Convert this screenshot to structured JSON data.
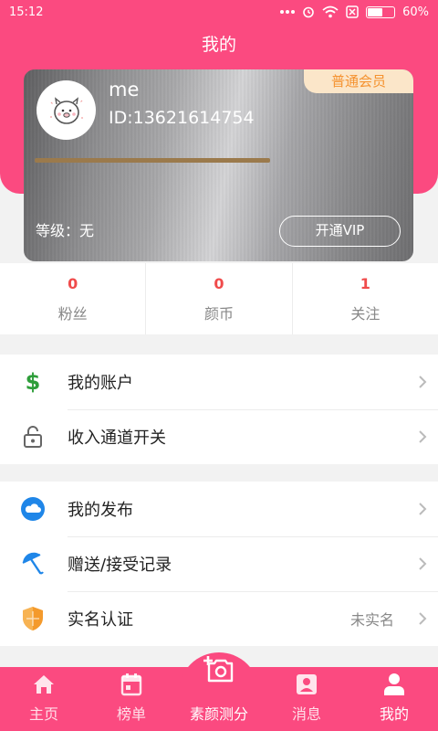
{
  "status_bar": {
    "time": "15:12",
    "battery": "60%",
    "battery_level": 0.6
  },
  "header": {
    "title": "我的"
  },
  "profile": {
    "username": "me",
    "id_text": "ID:13621614754",
    "member_badge": "普通会员",
    "level_text": "等级：无",
    "vip_button": "开通VIP",
    "progress": 1.0
  },
  "stats": [
    {
      "value": "0",
      "label": "粉丝"
    },
    {
      "value": "0",
      "label": "颜币"
    },
    {
      "value": "1",
      "label": "关注"
    }
  ],
  "menu_group1": [
    {
      "label": "我的账户",
      "icon": "dollar-icon"
    },
    {
      "label": "收入通道开关",
      "icon": "lock-icon"
    }
  ],
  "menu_group2": [
    {
      "label": "我的发布",
      "icon": "cloud-icon"
    },
    {
      "label": "赠送/接受记录",
      "icon": "umbrella-icon"
    },
    {
      "label": "实名认证",
      "icon": "shield-icon",
      "status": "未实名"
    }
  ],
  "tabs": [
    {
      "label": "主页",
      "icon": "home-icon"
    },
    {
      "label": "榜单",
      "icon": "calendar-icon"
    },
    {
      "label": "素颜测分",
      "icon": "camera-plus-icon"
    },
    {
      "label": "消息",
      "icon": "message-icon"
    },
    {
      "label": "我的",
      "icon": "person-icon",
      "active": true
    }
  ],
  "colors": {
    "brand_pink": "#fb4a80",
    "stat_red": "#f04b4b",
    "badge_orange": "#f5922f"
  }
}
